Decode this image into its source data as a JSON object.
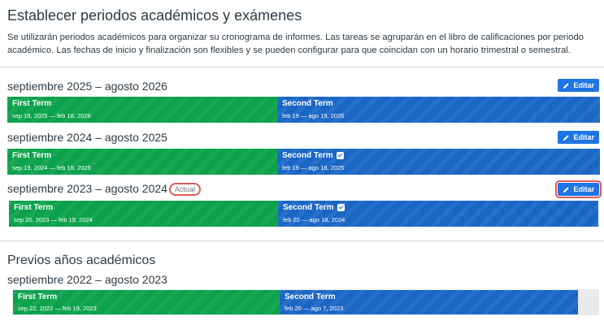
{
  "page": {
    "title": "Establecer periodos académicos y exámenes",
    "description": "Se utilizarán periodos académicos para organizar su cronograma de informes. Las tareas se agruparán en el libro de calificaciones por periodo académico. Las fechas de inicio y finalización son flexibles y se pueden configurar para que coincidan con un horario trimestral o semestral."
  },
  "edit_label": "Editar",
  "current_years": [
    {
      "label": "septiembre 2025 – agosto 2026",
      "badge": "",
      "terms": [
        {
          "name": "First Term",
          "dates": "sep 19, 2025 — feb 18, 2026",
          "checked": false
        },
        {
          "name": "Second Term",
          "dates": "feb 19 — ago 19, 2026",
          "checked": false
        }
      ]
    },
    {
      "label": "septiembre 2024 – agosto 2025",
      "badge": "",
      "terms": [
        {
          "name": "First Term",
          "dates": "sep 19, 2024 — feb 18, 2025",
          "checked": false
        },
        {
          "name": "Second Term",
          "dates": "feb 19 — ago 18, 2025",
          "checked": true
        }
      ]
    },
    {
      "label": "septiembre 2023 – agosto 2024",
      "badge": "Actual",
      "terms": [
        {
          "name": "First Term",
          "dates": "sep 20, 2023 — feb 19, 2024",
          "checked": false
        },
        {
          "name": "Second Term",
          "dates": "feb 20 — ago 18, 2024",
          "checked": true
        }
      ]
    }
  ],
  "previous": {
    "title": "Previos años académicos",
    "years": [
      {
        "label": "septiembre 2022 – agosto 2023",
        "terms": [
          {
            "name": "First Term",
            "dates": "sep 22, 2022 — feb 19, 2023",
            "checked": false
          },
          {
            "name": "Second Term",
            "dates": "feb 20 — ago 7, 2023",
            "checked": false
          }
        ]
      }
    ]
  },
  "colors": {
    "first_term": "#0ba24b",
    "second_term": "#1a66c5",
    "edit_button": "#1f75e3",
    "highlight": "#e05a5a"
  }
}
